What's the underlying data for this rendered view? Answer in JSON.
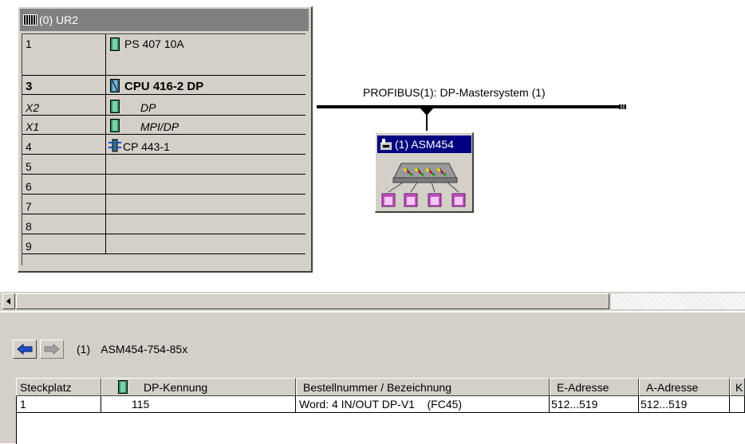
{
  "rack": {
    "title": "(0) UR2",
    "rows": [
      {
        "slot": "1",
        "module": "PS 407 10A"
      },
      {
        "slot": "3",
        "module": "CPU 416-2 DP"
      },
      {
        "slot": "X2",
        "module": "DP"
      },
      {
        "slot": "X1",
        "module": "MPI/DP"
      },
      {
        "slot": "4",
        "module": "CP 443-1"
      },
      {
        "slot": "5",
        "module": ""
      },
      {
        "slot": "6",
        "module": ""
      },
      {
        "slot": "7",
        "module": ""
      },
      {
        "slot": "8",
        "module": ""
      },
      {
        "slot": "9",
        "module": ""
      }
    ]
  },
  "network": {
    "bus_label": "PROFIBUS(1): DP-Mastersystem (1)",
    "station_title": "(1) ASM454"
  },
  "detail": {
    "station_number": "(1)",
    "station_name": "ASM454-754-85x",
    "columns": [
      "Steckplatz",
      "DP-Kennung",
      "Bestellnummer / Bezeichnung",
      "E-Adresse",
      "A-Adresse",
      "K"
    ],
    "rows": [
      {
        "steckplatz": "1",
        "dp_kennung": "115",
        "bezeichnung": "Word: 4 IN/OUT DP-V1    (FC45)",
        "e_adresse": "512...519",
        "a_adresse": "512...519"
      }
    ]
  },
  "colors": {
    "window_bg": "#d4d0c8",
    "active_title": "#000080",
    "inactive_title": "#808080",
    "nav_arrow": "#1e4fc8"
  }
}
